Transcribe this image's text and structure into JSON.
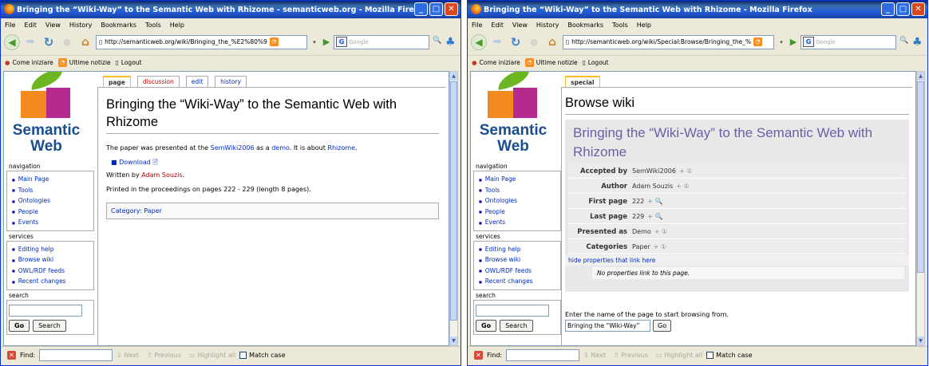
{
  "left": {
    "title": "Bringing the “Wiki-Way” to the Semantic Web with Rhizome - semanticweb.org - Mozilla Firefox",
    "url": "http://semanticweb.org/wiki/Bringing_the_%E2%80%9",
    "tabs": [
      "page",
      "discussion",
      "edit",
      "history"
    ],
    "heading": "Bringing the “Wiki-Way” to the Semantic Web with Rhizome",
    "para1_pre": "The paper was presented at the ",
    "para1_link1": "SemWiki2006",
    "para1_mid": " as a ",
    "para1_link2": "demo",
    "para1_mid2": ". It is about ",
    "para1_link3": "Rhizome",
    "para1_post": ".",
    "download": "Download",
    "written_pre": "Written by ",
    "written_link": "Adam Souzis",
    "written_post": ".",
    "printed": "Printed in the proceedings on pages 222 - 229 (length 8 pages).",
    "category": "Category: Paper"
  },
  "right": {
    "title": "Bringing the “Wiki-Way” to the Semantic Web with Rhizome - Mozilla Firefox",
    "url": "http://semanticweb.org/wiki/Special:Browse/Bringing_the_%",
    "tab": "special",
    "heading": "Browse wiki",
    "fact_title": "Bringing the “Wiki-Way” to the Semantic Web with Rhizome",
    "facts": [
      {
        "prop": "Accepted by",
        "value": "SemWiki2006",
        "icon": "+ ①"
      },
      {
        "prop": "Author",
        "value": "Adam Souzis",
        "icon": "+ ①"
      },
      {
        "prop": "First page",
        "value": "222",
        "icon": "+ 🔍"
      },
      {
        "prop": "Last page",
        "value": "229",
        "icon": "+ 🔍"
      },
      {
        "prop": "Presented as",
        "value": "Demo",
        "icon": "+ ①"
      },
      {
        "prop": "Categories",
        "value": "Paper",
        "icon": "+ ①"
      }
    ],
    "hide_props": "hide properties that link here",
    "no_props": "No properties link to this page.",
    "enter_page": "Enter the name of the page to start browsing from.",
    "browse_value": "Bringing the “Wiki-Way”",
    "go": "Go"
  },
  "menu": [
    "File",
    "Edit",
    "View",
    "History",
    "Bookmarks",
    "Tools",
    "Help"
  ],
  "bookmarks": [
    "Come iniziare",
    "Ultime notizie",
    "Logout"
  ],
  "search_placeholder": "Google",
  "logo_line1": "Semantic",
  "logo_line2": "Web",
  "nav_title": "navigation",
  "nav_items": [
    "Main Page",
    "Tools",
    "Ontologies",
    "People",
    "Events"
  ],
  "services_title": "services",
  "services_items": [
    "Editing help",
    "Browse wiki",
    "OWL/RDF feeds",
    "Recent changes"
  ],
  "search_title": "search",
  "go_label": "Go",
  "search_label": "Search",
  "find": {
    "label": "Find:",
    "next": "Next",
    "previous": "Previous",
    "highlight": "Highlight all",
    "match": "Match case"
  }
}
